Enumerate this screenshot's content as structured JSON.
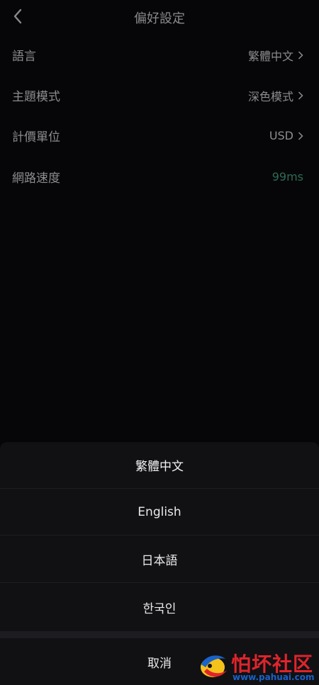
{
  "header": {
    "title": "偏好設定"
  },
  "settings": [
    {
      "label": "語言",
      "value": "繁體中文"
    },
    {
      "label": "主題模式",
      "value": "深色模式"
    },
    {
      "label": "計價單位",
      "value": "USD"
    },
    {
      "label": "網路速度",
      "value": "99ms"
    }
  ],
  "sheet": {
    "options": [
      "繁體中文",
      "English",
      "日本語",
      "한국인"
    ],
    "selected": "繁體中文",
    "cancel_label": "取消"
  },
  "watermark": {
    "text": "怕坏社区",
    "url": "www.pahuai.com"
  },
  "colors": {
    "background": "#060608",
    "sheet": "#111114",
    "speed": "#2f6b55",
    "watermark_red": "#e0242b",
    "watermark_blue": "#1a62c9"
  }
}
